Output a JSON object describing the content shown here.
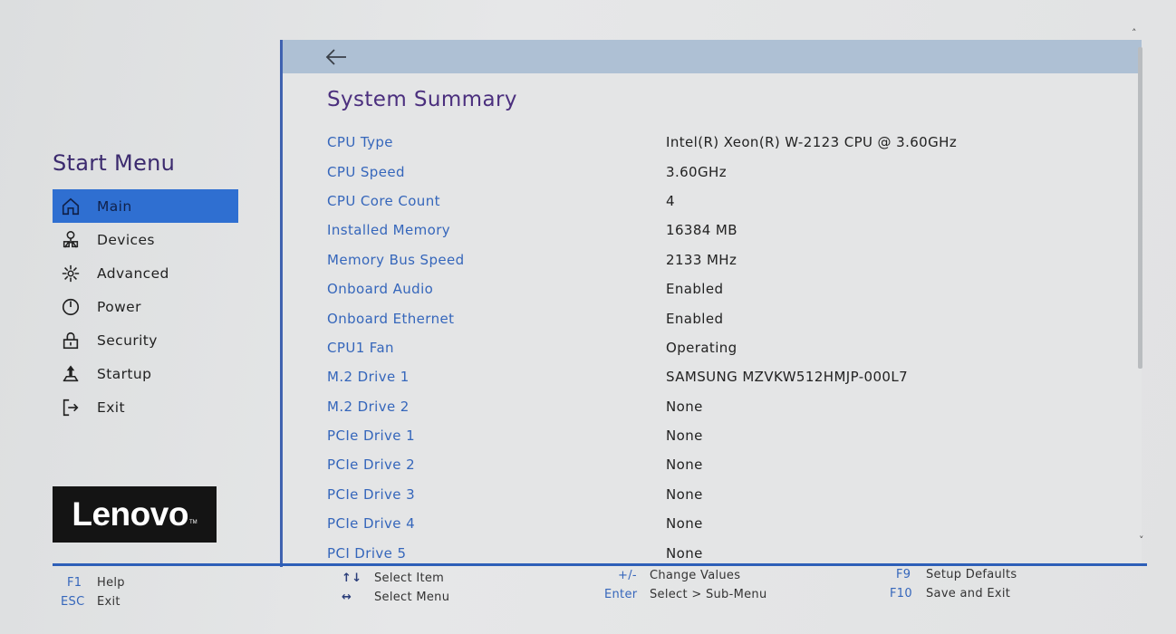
{
  "sidebar": {
    "title": "Start Menu",
    "items": [
      {
        "label": "Main",
        "icon": "home-icon",
        "active": true
      },
      {
        "label": "Devices",
        "icon": "devices-icon",
        "active": false
      },
      {
        "label": "Advanced",
        "icon": "advanced-icon",
        "active": false
      },
      {
        "label": "Power",
        "icon": "power-icon",
        "active": false
      },
      {
        "label": "Security",
        "icon": "lock-icon",
        "active": false
      },
      {
        "label": "Startup",
        "icon": "startup-icon",
        "active": false
      },
      {
        "label": "Exit",
        "icon": "exit-icon",
        "active": false
      }
    ],
    "logo": "Lenovo"
  },
  "panel": {
    "title": "System Summary",
    "rows": [
      {
        "label": "CPU Type",
        "value": "Intel(R) Xeon(R) W-2123 CPU @ 3.60GHz"
      },
      {
        "label": "CPU Speed",
        "value": "3.60GHz"
      },
      {
        "label": "CPU Core Count",
        "value": "4"
      },
      {
        "label": "Installed Memory",
        "value": "16384 MB"
      },
      {
        "label": "Memory Bus Speed",
        "value": "2133 MHz"
      },
      {
        "label": "Onboard Audio",
        "value": "Enabled"
      },
      {
        "label": "Onboard Ethernet",
        "value": "Enabled"
      },
      {
        "label": "CPU1 Fan",
        "value": "Operating"
      },
      {
        "label": "M.2 Drive 1",
        "value": "SAMSUNG MZVKW512HMJP-000L7"
      },
      {
        "label": "M.2 Drive 2",
        "value": "None"
      },
      {
        "label": "PCIe Drive 1",
        "value": "None"
      },
      {
        "label": "PCIe Drive 2",
        "value": "None"
      },
      {
        "label": "PCIe Drive 3",
        "value": "None"
      },
      {
        "label": "PCIe Drive 4",
        "value": "None"
      },
      {
        "label": "PCI Drive 5",
        "value": "None"
      }
    ]
  },
  "footer": {
    "f1_key": "F1",
    "f1_desc": "Help",
    "esc_key": "ESC",
    "esc_desc": "Exit",
    "select_item_key": "↑↓",
    "select_item_desc": "Select Item",
    "select_menu_key": "↔",
    "select_menu_desc": "Select Menu",
    "change_key": "+/-",
    "change_desc": "Change Values",
    "enter_key": "Enter",
    "enter_desc": "Select > Sub-Menu",
    "f9_key": "F9",
    "f9_desc": "Setup Defaults",
    "f10_key": "F10",
    "f10_desc": "Save and Exit"
  },
  "colors": {
    "accent": "#2f6fd1",
    "label_blue": "#3566bb",
    "title_purple": "#4b2f7e",
    "header_bar": "#aec0d4"
  }
}
